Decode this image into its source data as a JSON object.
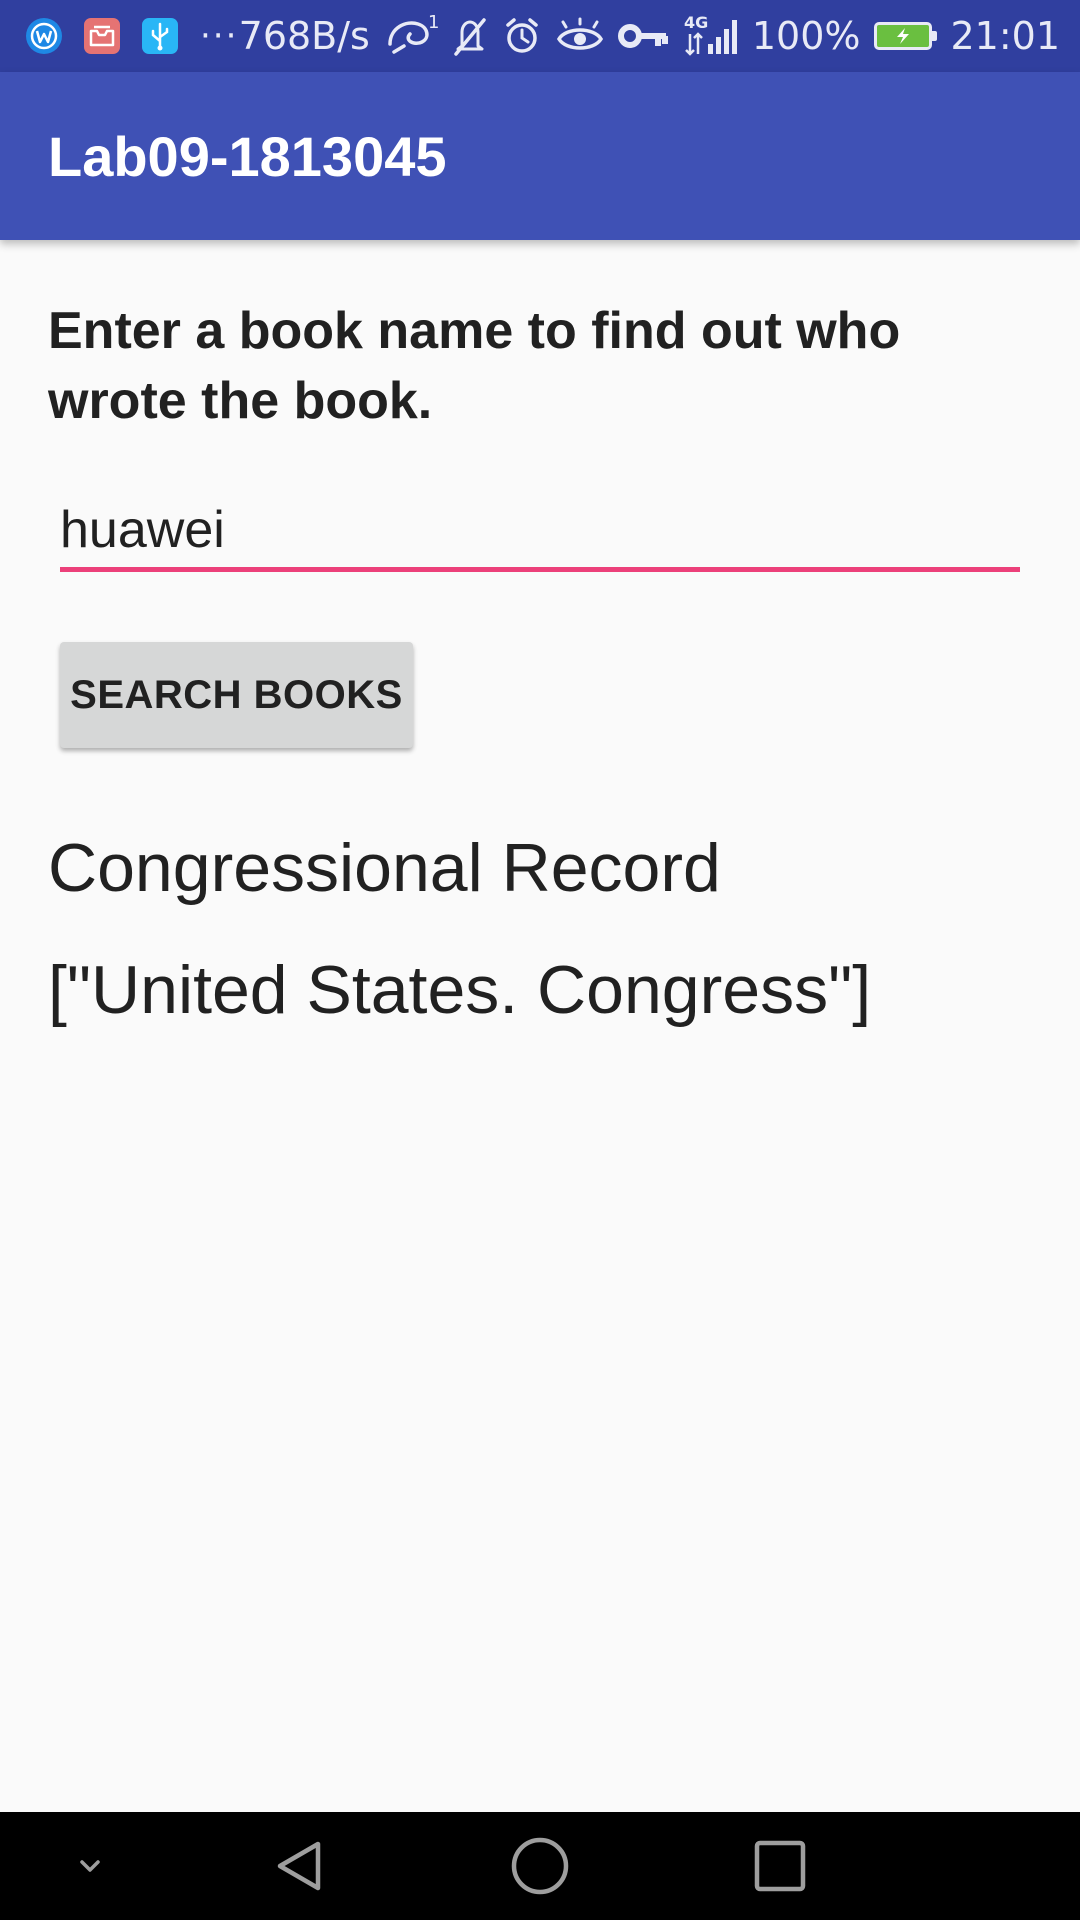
{
  "status_bar": {
    "net_speed": "768B/s",
    "sim_badge": "1",
    "network_type": "4G",
    "battery_percent": "100%",
    "time": "21:01",
    "overflow_dots": "···"
  },
  "app_bar": {
    "title": "Lab09-1813045"
  },
  "main": {
    "prompt": "Enter a book name to find out who wrote the book.",
    "input_value": "huawei",
    "search_button_label": "SEARCH BOOKS",
    "result_title": "Congressional Record",
    "result_authors": "[\"United States. Congress\"]"
  },
  "colors": {
    "status_bar": "#303f9f",
    "app_bar": "#3f51b5",
    "input_underline": "#ec407a",
    "button_bg": "#d6d7d7",
    "background": "#fafafa"
  },
  "icons": {
    "status_left": [
      "w-app-icon",
      "mail-app-icon",
      "usb-icon"
    ],
    "status_right": [
      "hotspot-icon",
      "mute-icon",
      "alarm-icon",
      "eye-icon",
      "vpn-key-icon",
      "signal-icon",
      "battery-icon"
    ],
    "nav": [
      "chevron-down-icon",
      "back-icon",
      "home-icon",
      "recents-icon"
    ]
  }
}
